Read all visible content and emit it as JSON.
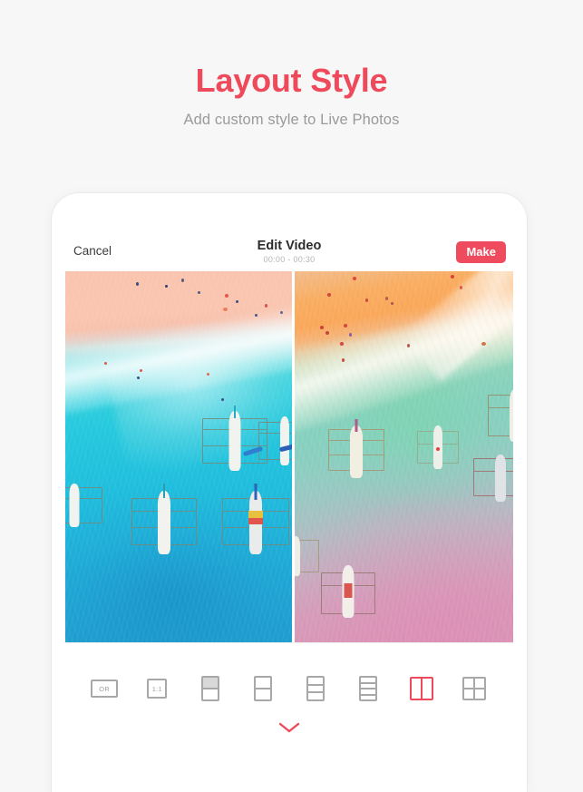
{
  "promo": {
    "title": "Layout Style",
    "subtitle": "Add custom style to Live Photos",
    "title_color": "#ef4a5c",
    "subtitle_color": "#9a9a9a",
    "background_color": "#f7f7f7"
  },
  "app": {
    "navbar": {
      "cancel_label": "Cancel",
      "title": "Edit Video",
      "time_range": "00:00 - 00:30",
      "make_label": "Make",
      "make_color": "#ee4b5e"
    },
    "preview": {
      "left_photo_name": "aerial-beach-photo-original",
      "right_photo_name": "aerial-beach-photo-styled",
      "split_mode": "two-columns"
    },
    "toolbar": {
      "selected_index": 6,
      "selected_color": "#ef4a5c",
      "idle_color": "#a8a8a8",
      "options": [
        {
          "id": "original",
          "label": "OR",
          "shape": "wide-rect",
          "name": "layout-original"
        },
        {
          "id": "square",
          "label": "1:1",
          "shape": "square",
          "name": "layout-square"
        },
        {
          "id": "split2top",
          "label": "",
          "shape": "rows-2-shaded",
          "rows": 2,
          "name": "layout-split-2-shaded"
        },
        {
          "id": "rows2",
          "label": "",
          "shape": "rows",
          "rows": 2,
          "name": "layout-rows-2"
        },
        {
          "id": "rows3",
          "label": "",
          "shape": "rows",
          "rows": 3,
          "name": "layout-rows-3"
        },
        {
          "id": "rows4",
          "label": "",
          "shape": "rows",
          "rows": 4,
          "name": "layout-rows-4"
        },
        {
          "id": "cols2",
          "label": "",
          "shape": "cols",
          "cols": 2,
          "name": "layout-cols-2"
        },
        {
          "id": "grid4",
          "label": "",
          "shape": "grid",
          "rows": 2,
          "cols": 2,
          "name": "layout-grid-2x2"
        }
      ],
      "chevron_icon": "chevron-down-icon",
      "chevron_color": "#ef4a5c"
    }
  }
}
